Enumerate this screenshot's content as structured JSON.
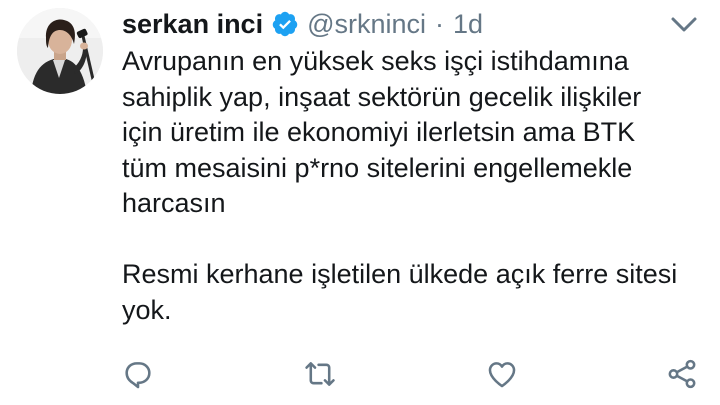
{
  "tweet": {
    "display_name": "serkan inci",
    "handle": "@srkninci",
    "separator": "·",
    "time": "1d",
    "verified": true,
    "lines_paragraph_1": [
      "Avrupanın en yüksek seks işçi istihdamına",
      "sahiplik yap, inşaat sektörün gecelik ilişkiler",
      "için üretim ile ekonomiyi ilerletsin ama BTK",
      "tüm mesaisini p*rno sitelerini engellemekle",
      "harcasın"
    ],
    "lines_paragraph_2": [
      "Resmi kerhane işletilen ülkede açık ferre sitesi",
      "yok."
    ]
  },
  "icons": {
    "caret": "chevron-down-icon",
    "verified": "verified-badge-icon",
    "reply": "reply-icon",
    "retweet": "retweet-icon",
    "like": "heart-icon",
    "share": "share-icon"
  },
  "colors": {
    "text": "#14171a",
    "secondary": "#657786",
    "verified_blue": "#1da1f2",
    "icon_gray": "#657786"
  }
}
